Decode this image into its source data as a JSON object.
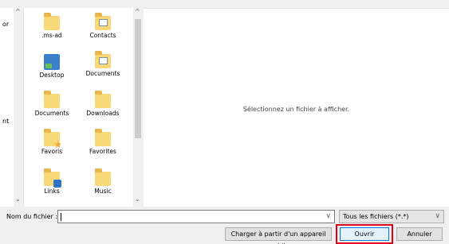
{
  "left_pane": {
    "stub_labels": [
      "or",
      "nt"
    ]
  },
  "files": [
    {
      "label": ".ms-ad",
      "icon": "folder-icon"
    },
    {
      "label": "Contacts",
      "icon": "contacts-folder-icon"
    },
    {
      "label": "Desktop",
      "icon": "desktop-icon"
    },
    {
      "label": "Documents",
      "icon": "documents-file-icon"
    },
    {
      "label": "Documents",
      "icon": "folder-icon"
    },
    {
      "label": "Downloads",
      "icon": "folder-icon"
    },
    {
      "label": "Favoris",
      "icon": "favorites-star-folder-icon"
    },
    {
      "label": "Favorites",
      "icon": "folder-icon"
    },
    {
      "label": "Links",
      "icon": "links-folder-icon"
    },
    {
      "label": "Music",
      "icon": "folder-icon"
    }
  ],
  "preview": {
    "message": "Sélectionnez un fichier à afficher."
  },
  "filename": {
    "label": "Nom du fichier :",
    "value": ""
  },
  "filter": {
    "selected": "Tous les fichiers (*.*)"
  },
  "buttons": {
    "upload": "Charger à partir d'un appareil mobile",
    "open": "Ouvrir",
    "cancel": "Annuler"
  },
  "glyphs": {
    "up": "^",
    "down": "⌄",
    "dropdown": "∨"
  },
  "colors": {
    "folder": "#f9d877",
    "highlight_outline": "#e0001b",
    "focus_border": "#0078d7"
  }
}
